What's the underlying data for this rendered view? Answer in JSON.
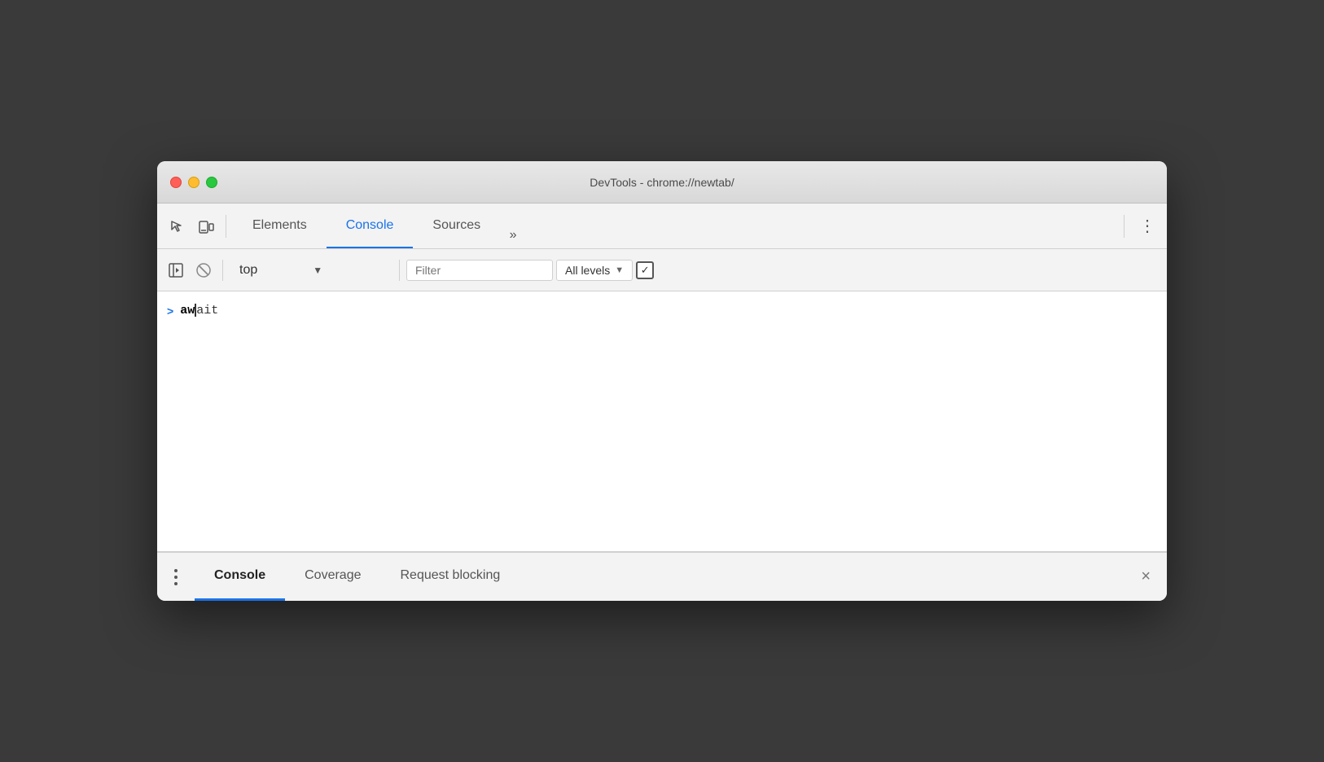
{
  "window": {
    "title": "DevTools - chrome://newtab/"
  },
  "traffic_lights": {
    "close_label": "close",
    "minimize_label": "minimize",
    "maximize_label": "maximize"
  },
  "devtools_toolbar": {
    "inspect_icon_label": "inspect-element-icon",
    "device_icon_label": "device-toggle-icon",
    "tabs": [
      {
        "id": "elements",
        "label": "Elements",
        "active": false
      },
      {
        "id": "console",
        "label": "Console",
        "active": true
      },
      {
        "id": "sources",
        "label": "Sources",
        "active": false
      }
    ],
    "more_tabs_label": "»",
    "menu_label": "⋮"
  },
  "console_toolbar": {
    "sidebar_icon_label": "console-sidebar-icon",
    "block_icon_label": "clear-console-icon",
    "context_label": "top",
    "context_arrow": "▼",
    "filter_placeholder": "Filter",
    "levels_label": "All levels",
    "levels_arrow": "▼",
    "checkbox_check": "✓"
  },
  "console_output": {
    "entries": [
      {
        "arrow": ">",
        "text_bold": "aw",
        "has_cursor": true,
        "text_normal": "ait"
      }
    ]
  },
  "bottom_drawer": {
    "menu_dots": 3,
    "tabs": [
      {
        "id": "console",
        "label": "Console",
        "active": true
      },
      {
        "id": "coverage",
        "label": "Coverage",
        "active": false
      },
      {
        "id": "request-blocking",
        "label": "Request blocking",
        "active": false
      }
    ],
    "close_label": "×"
  },
  "colors": {
    "active_tab_blue": "#1a73e8",
    "title_bar_bg": "#e0e0e0",
    "toolbar_bg": "#f3f3f3",
    "border": "#d0d0d0"
  }
}
